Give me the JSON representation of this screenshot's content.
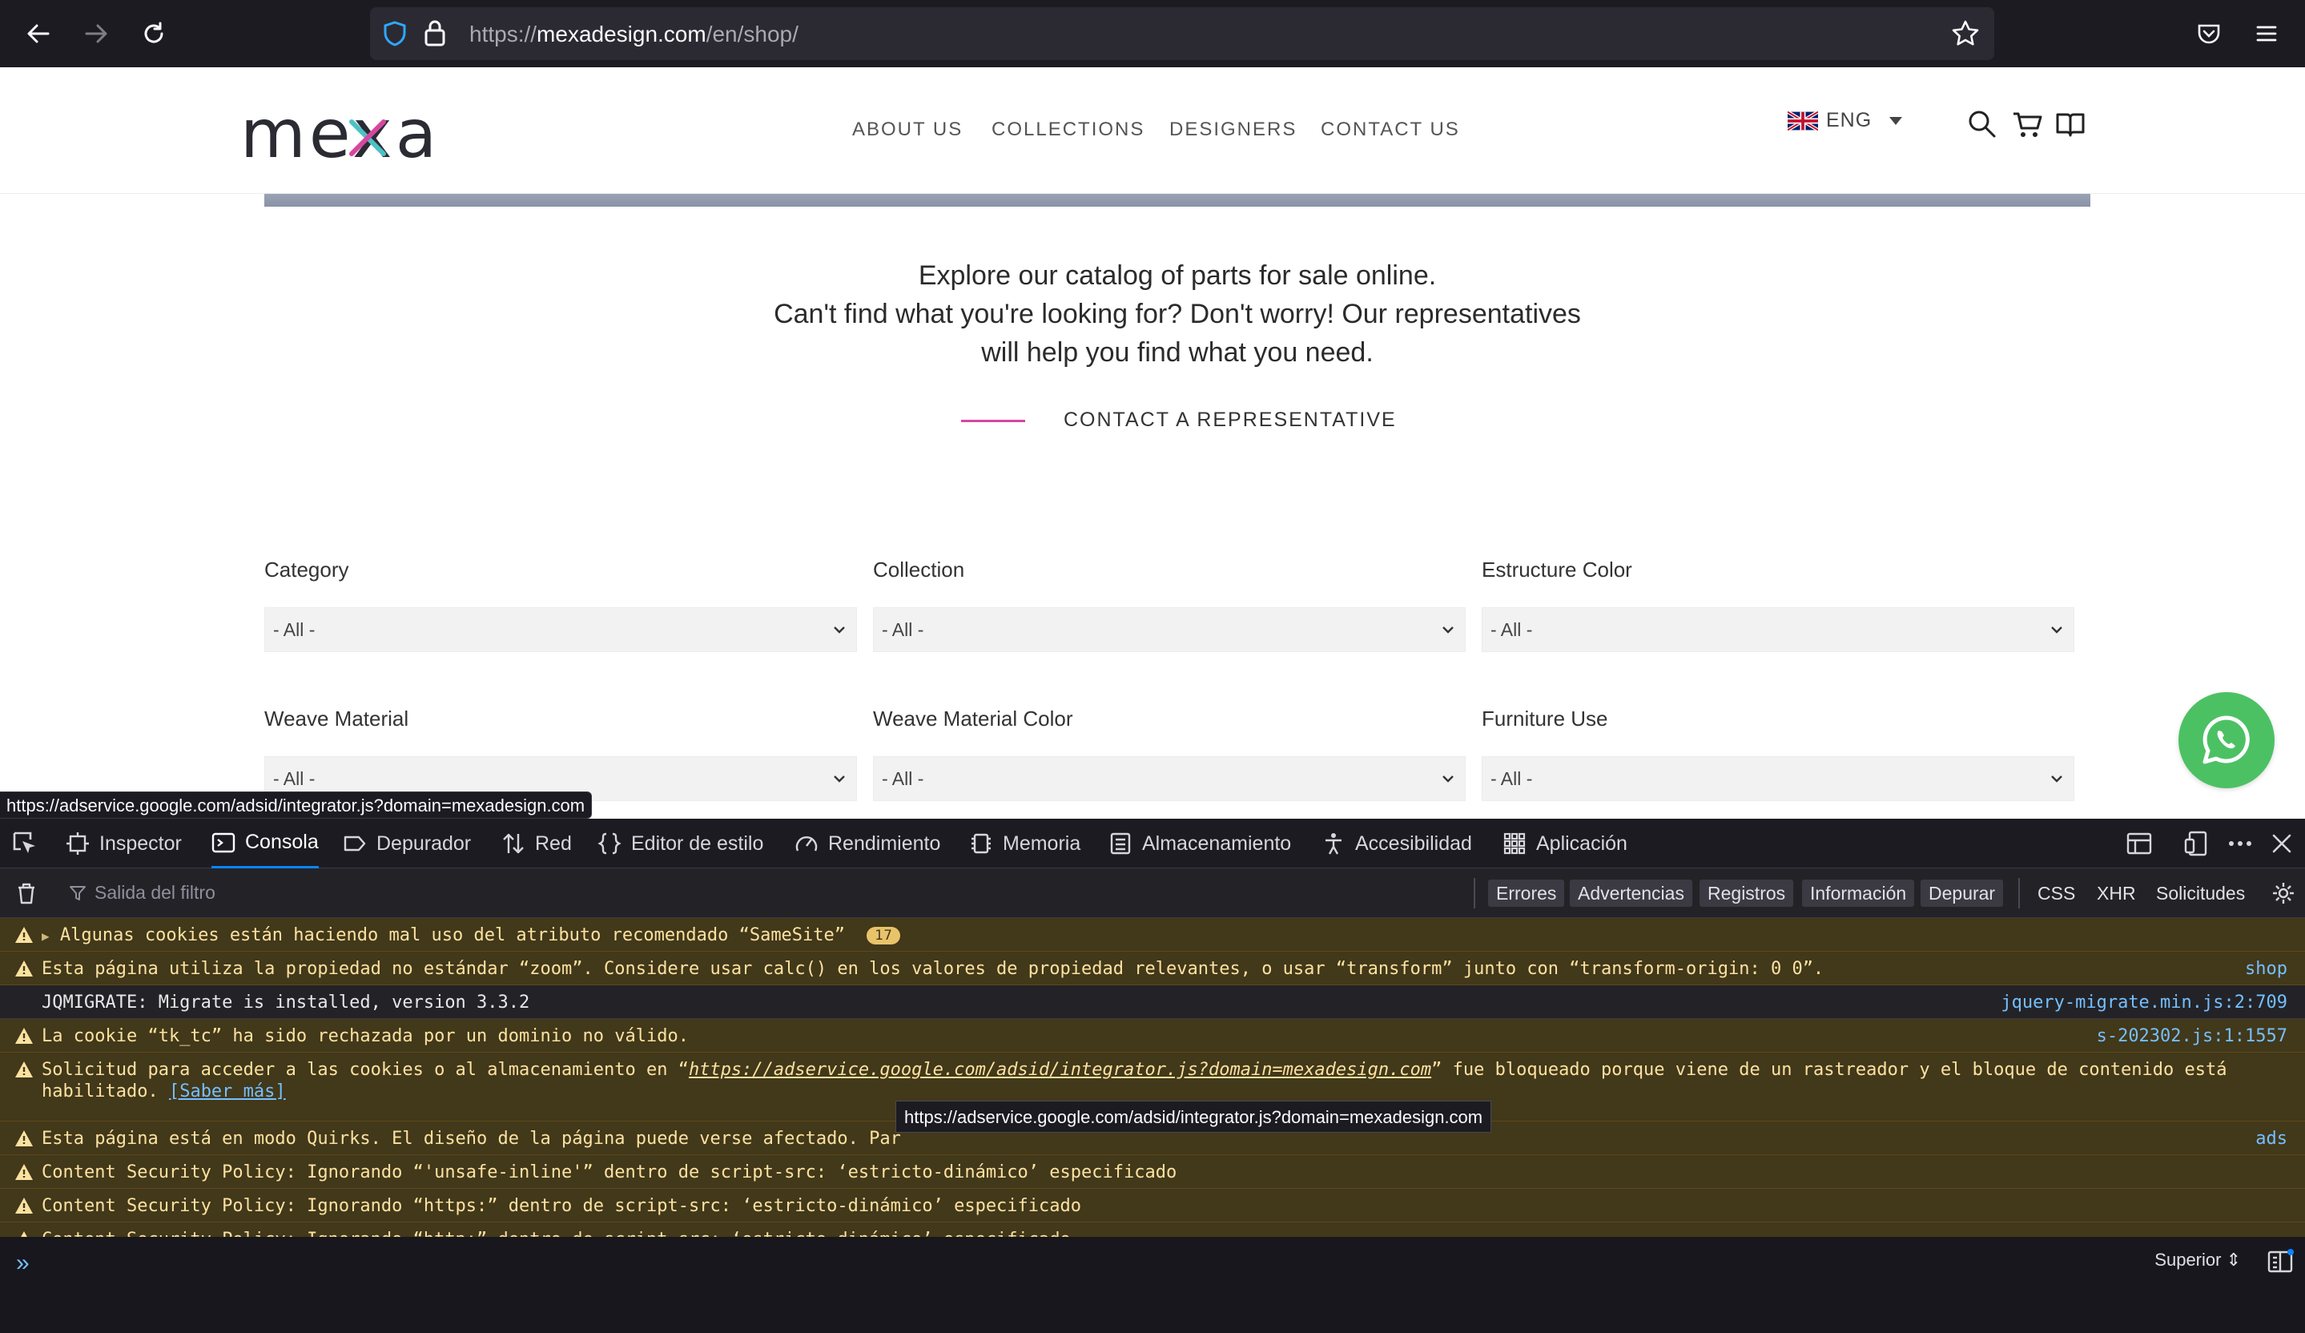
{
  "browser": {
    "url_prefix": "https://",
    "url_host": "mexadesign.com",
    "url_path": "/en/shop/"
  },
  "site": {
    "logo": "mexa",
    "nav": [
      "ABOUT US",
      "COLLECTIONS",
      "DESIGNERS",
      "CONTACT US"
    ],
    "language": "ENG",
    "intro_lines": [
      "Explore our catalog of parts for sale online.",
      "Can't find what you're looking for? Don't worry! Our representatives",
      "will help you find what you need."
    ],
    "cta": "CONTACT A REPRESENTATIVE",
    "filters": [
      {
        "label": "Category",
        "value": "- All -"
      },
      {
        "label": "Collection",
        "value": "- All -"
      },
      {
        "label": "Estructure Color",
        "value": "- All -"
      },
      {
        "label": "Weave Material",
        "value": "- All -"
      },
      {
        "label": "Weave Material Color",
        "value": "- All -"
      },
      {
        "label": "Furniture Use",
        "value": "- All -"
      }
    ],
    "accent": "#d6479f"
  },
  "status_link": "https://adservice.google.com/adsid/integrator.js?domain=mexadesign.com",
  "devtools": {
    "tabs": [
      "Inspector",
      "Consola",
      "Depurador",
      "Red",
      "Editor de estilo",
      "Rendimiento",
      "Memoria",
      "Almacenamiento",
      "Accesibilidad",
      "Aplicación"
    ],
    "active_tab": "Consola",
    "filter_placeholder": "Salida del filtro",
    "levels": [
      "Errores",
      "Advertencias",
      "Registros",
      "Información",
      "Depurar"
    ],
    "extra_filters": [
      "CSS",
      "XHR",
      "Solicitudes"
    ],
    "messages": [
      {
        "type": "warn",
        "text": "Algunas cookies están haciendo mal uso del atributo recomendado “SameSite”",
        "badge": "17",
        "src": ""
      },
      {
        "type": "warn",
        "text": "Esta página utiliza la propiedad no estándar “zoom”. Considere usar calc() en los valores de propiedad relevantes, o usar “transform” junto con “transform-origin: 0 0”.",
        "src": "shop"
      },
      {
        "type": "info",
        "text": "JQMIGRATE: Migrate is installed, version 3.3.2",
        "src": "jquery-migrate.min.js:2:709"
      },
      {
        "type": "warn",
        "text": "La cookie “tk_tc” ha sido rechazada por un dominio no válido.",
        "src": "s-202302.js:1:1557"
      },
      {
        "type": "warn",
        "text_a": "Solicitud para acceder a las cookies o al almacenamiento en “",
        "link": "https://adservice.google.com/adsid/integrator.js?domain=mexadesign.com",
        "text_b": "” fue bloqueado porque viene de un rastreador y el bloque de contenido está",
        "text_c": "habilitado.",
        "more": "[Saber más]",
        "src": ""
      },
      {
        "type": "warn",
        "text": "Esta página está en modo Quirks. El diseño de la página puede verse afectado. Par",
        "src": "ads"
      },
      {
        "type": "warn",
        "text": "Content Security Policy: Ignorando “'unsafe-inline'” dentro de script-src: ‘estricto-dinámico’ especificado",
        "src": ""
      },
      {
        "type": "warn",
        "text": "Content Security Policy: Ignorando “https:” dentro de script-src: ‘estricto-dinámico’ especificado",
        "src": ""
      },
      {
        "type": "warn",
        "text": "Content Security Policy: Ignorando “http:” dentro de script-src: ‘estricto-dinámico’ especificado",
        "src": ""
      }
    ],
    "tooltip": "https://adservice.google.com/adsid/integrator.js?domain=mexadesign.com",
    "context_selector": "Superior"
  }
}
